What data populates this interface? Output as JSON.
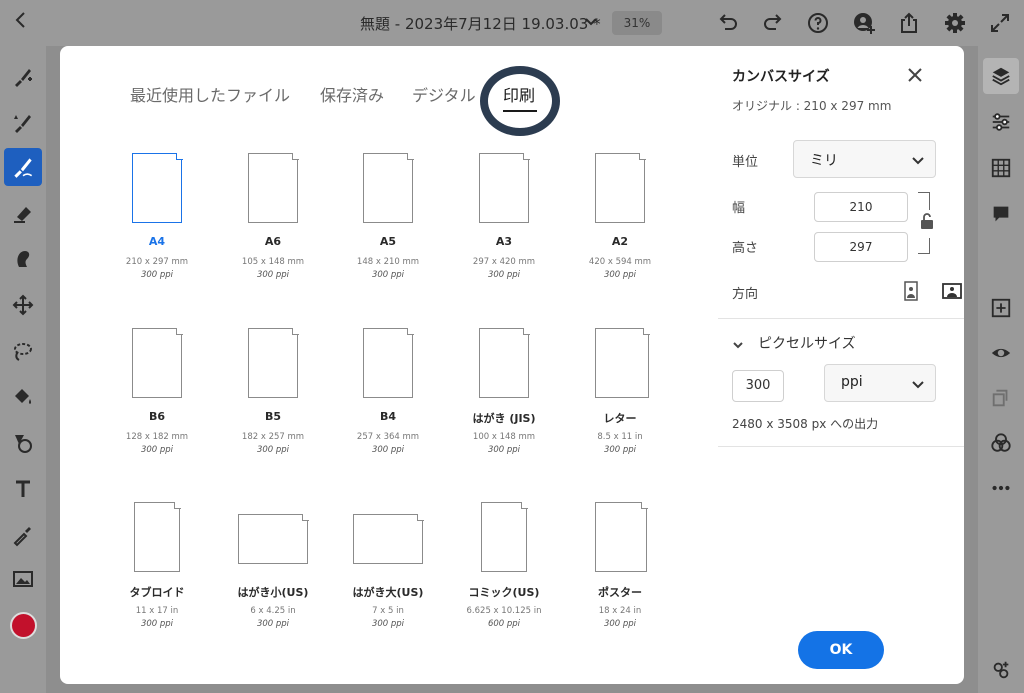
{
  "topbar": {
    "title": "無題 - 2023年7月12日 19.03.03 *",
    "zoom": "31%"
  },
  "tabs": [
    {
      "label": "最近使用したファイル"
    },
    {
      "label": "保存済み"
    },
    {
      "label": "デジタル"
    },
    {
      "label": "印刷"
    }
  ],
  "presets": [
    {
      "name": "A4",
      "size": "210 x 297 mm",
      "ppi": "300 ppi",
      "selected": true
    },
    {
      "name": "A6",
      "size": "105 x 148 mm",
      "ppi": "300 ppi"
    },
    {
      "name": "A5",
      "size": "148 x 210 mm",
      "ppi": "300 ppi"
    },
    {
      "name": "A3",
      "size": "297 x 420 mm",
      "ppi": "300 ppi"
    },
    {
      "name": "A2",
      "size": "420 x 594 mm",
      "ppi": "300 ppi"
    },
    {
      "name": "B6",
      "size": "128 x 182 mm",
      "ppi": "300 ppi"
    },
    {
      "name": "B5",
      "size": "182 x 257 mm",
      "ppi": "300 ppi"
    },
    {
      "name": "B4",
      "size": "257 x 364 mm",
      "ppi": "300 ppi"
    },
    {
      "name": "はがき (JIS)",
      "size": "100 x 148 mm",
      "ppi": "300 ppi"
    },
    {
      "name": "レター",
      "size": "8.5 x 11 in",
      "ppi": "300 ppi"
    },
    {
      "name": "タブロイド",
      "size": "11 x 17 in",
      "ppi": "300 ppi"
    },
    {
      "name": "はがき小(US)",
      "size": "6 x 4.25 in",
      "ppi": "300 ppi"
    },
    {
      "name": "はがき大(US)",
      "size": "7 x 5 in",
      "ppi": "300 ppi"
    },
    {
      "name": "コミック(US)",
      "size": "6.625 x 10.125 in",
      "ppi": "600 ppi"
    },
    {
      "name": "ポスター",
      "size": "18 x 24 in",
      "ppi": "300 ppi"
    }
  ],
  "pane": {
    "title": "カンバスサイズ",
    "original": "オリジナル : 210 x 297 mm",
    "unit_label": "単位",
    "unit_value": "ミリ",
    "width_label": "幅",
    "width_value": "210",
    "height_label": "高さ",
    "height_value": "297",
    "orientation_label": "方向",
    "pixel_title": "ピクセルサイズ",
    "resolution_value": "300",
    "resolution_unit": "ppi",
    "output_text": "2480 x 3508 px への出力",
    "ok_label": "OK"
  },
  "colors": {
    "accent": "#1473e6",
    "selected": "#1a73e8",
    "current_color": "#c2112c",
    "highlight_ring": "#2c3c50"
  }
}
